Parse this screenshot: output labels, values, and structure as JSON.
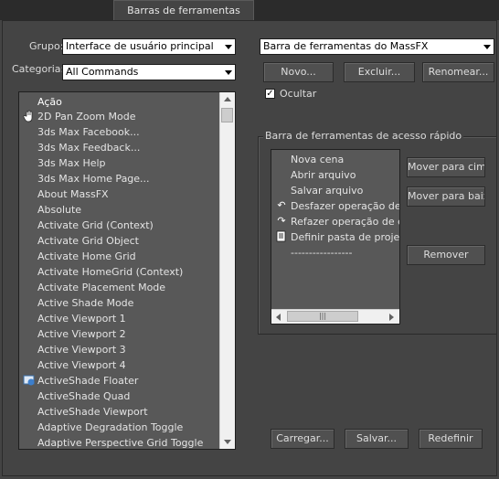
{
  "tab": {
    "label": "Barras de ferramentas"
  },
  "left": {
    "group_label": "Grupo:",
    "group_value": "Interface de usuário principal",
    "category_label": "Categoria:",
    "category_value": "All Commands",
    "list": [
      {
        "label": "Ação",
        "icon": ""
      },
      {
        "label": "2D Pan Zoom Mode",
        "icon": "hand-icon"
      },
      {
        "label": "3ds Max Facebook...",
        "icon": ""
      },
      {
        "label": "3ds Max Feedback...",
        "icon": ""
      },
      {
        "label": "3ds Max Help",
        "icon": ""
      },
      {
        "label": "3ds Max Home Page...",
        "icon": ""
      },
      {
        "label": "About MassFX",
        "icon": ""
      },
      {
        "label": "Absolute",
        "icon": ""
      },
      {
        "label": "Activate Grid (Context)",
        "icon": ""
      },
      {
        "label": "Activate Grid Object",
        "icon": ""
      },
      {
        "label": "Activate Home Grid",
        "icon": ""
      },
      {
        "label": "Activate HomeGrid (Context)",
        "icon": ""
      },
      {
        "label": "Activate Placement Mode",
        "icon": ""
      },
      {
        "label": "Active Shade Mode",
        "icon": ""
      },
      {
        "label": "Active Viewport 1",
        "icon": ""
      },
      {
        "label": "Active Viewport 2",
        "icon": ""
      },
      {
        "label": "Active Viewport 3",
        "icon": ""
      },
      {
        "label": "Active Viewport 4",
        "icon": ""
      },
      {
        "label": "ActiveShade Floater",
        "icon": "activeshade-icon"
      },
      {
        "label": "ActiveShade Quad",
        "icon": ""
      },
      {
        "label": "ActiveShade Viewport",
        "icon": ""
      },
      {
        "label": "Adaptive Degradation Toggle",
        "icon": ""
      },
      {
        "label": "Adaptive Perspective Grid Toggle",
        "icon": ""
      }
    ]
  },
  "right": {
    "toolbar_value": "Barra de ferramentas do MassFX",
    "new_label": "Novo...",
    "delete_label": "Excluir...",
    "rename_label": "Renomear...",
    "hide_label": "Ocultar",
    "hide_checked": true,
    "quick_group_title": "Barra de ferramentas de acesso rápido",
    "quick_list": [
      {
        "label": "Nova cena",
        "icon": ""
      },
      {
        "label": "Abrir arquivo",
        "icon": ""
      },
      {
        "label": "Salvar arquivo",
        "icon": ""
      },
      {
        "label": "Desfazer operação de ce",
        "icon": "undo-icon"
      },
      {
        "label": "Refazer operação de cer",
        "icon": "redo-icon"
      },
      {
        "label": "Definir pasta de projeto.",
        "icon": "project-folder-icon"
      },
      {
        "label": "-----------------",
        "icon": ""
      }
    ],
    "move_up_label": "Mover para cima",
    "move_down_label": "Mover para baixo",
    "remove_label": "Remover"
  },
  "footer": {
    "load_label": "Carregar...",
    "save_label": "Salvar...",
    "reset_label": "Redefinir"
  }
}
